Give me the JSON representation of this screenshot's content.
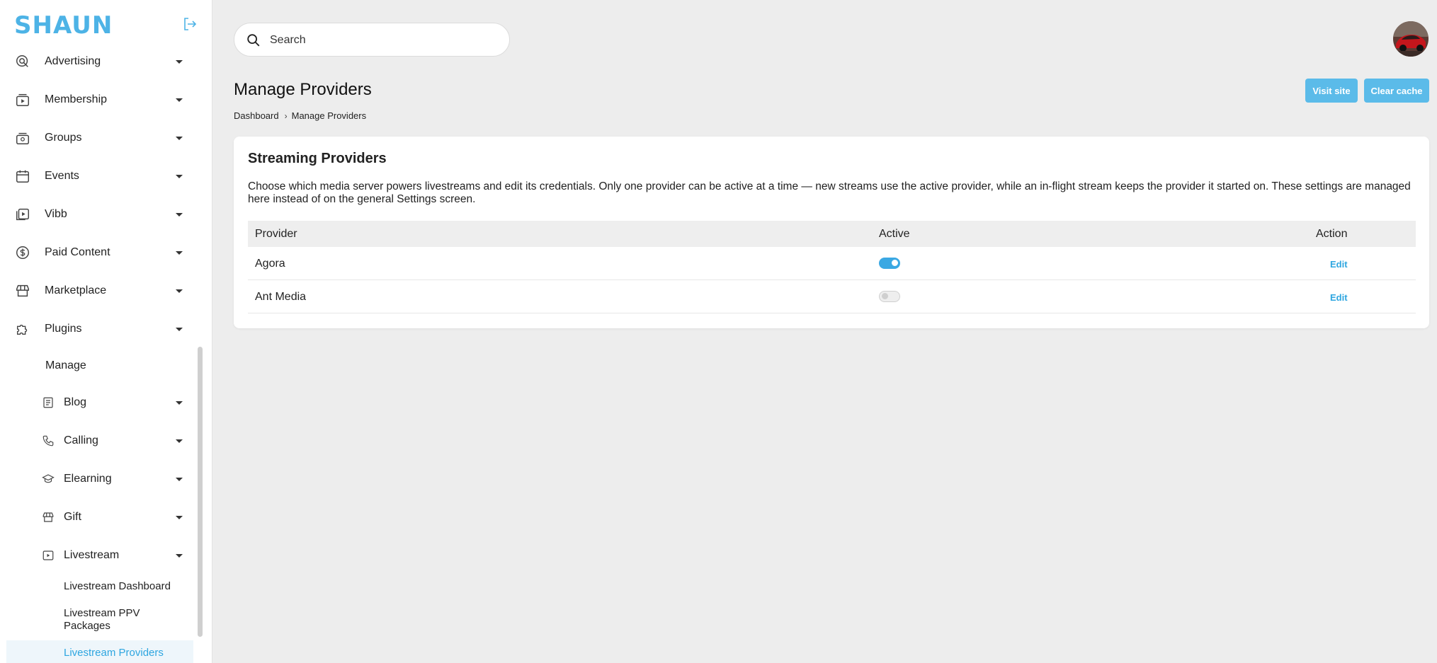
{
  "brand": {
    "logo_text": "SHAUN",
    "accent": "#4db3e6"
  },
  "sidebar": {
    "items": [
      {
        "label": "Advertising",
        "icon": "advertising-icon"
      },
      {
        "label": "Membership",
        "icon": "membership-icon"
      },
      {
        "label": "Groups",
        "icon": "groups-icon"
      },
      {
        "label": "Events",
        "icon": "calendar-icon"
      },
      {
        "label": "Vibb",
        "icon": "vibb-icon"
      },
      {
        "label": "Paid Content",
        "icon": "dollar-icon"
      },
      {
        "label": "Marketplace",
        "icon": "store-icon"
      },
      {
        "label": "Plugins",
        "icon": "puzzle-icon"
      }
    ],
    "plugins_manage": "Manage",
    "plugin_items": [
      {
        "label": "Blog",
        "icon": "blog-icon"
      },
      {
        "label": "Calling",
        "icon": "phone-icon"
      },
      {
        "label": "Elearning",
        "icon": "graduation-cap-icon"
      },
      {
        "label": "Gift",
        "icon": "gift-icon"
      },
      {
        "label": "Livestream",
        "icon": "play-icon"
      }
    ],
    "livestream_items": [
      {
        "label": "Livestream Dashboard"
      },
      {
        "label": "Livestream PPV Packages"
      },
      {
        "label": "Livestream Providers"
      }
    ]
  },
  "search": {
    "placeholder": "Search"
  },
  "header": {
    "title": "Manage Providers",
    "visit_site": "Visit site",
    "clear_cache": "Clear cache"
  },
  "breadcrumb": {
    "home": "Dashboard",
    "current": "Manage Providers"
  },
  "card": {
    "title": "Streaming Providers",
    "description": "Choose which media server powers livestreams and edit its credentials. Only one provider can be active at a time — new streams use the active provider, while an in-flight stream keeps the provider it started on. These settings are managed here instead of on the general Settings screen.",
    "columns": {
      "provider": "Provider",
      "active": "Active",
      "action": "Action"
    },
    "rows": [
      {
        "provider": "Agora",
        "active": true,
        "action": "Edit"
      },
      {
        "provider": "Ant Media",
        "active": false,
        "action": "Edit"
      }
    ]
  }
}
